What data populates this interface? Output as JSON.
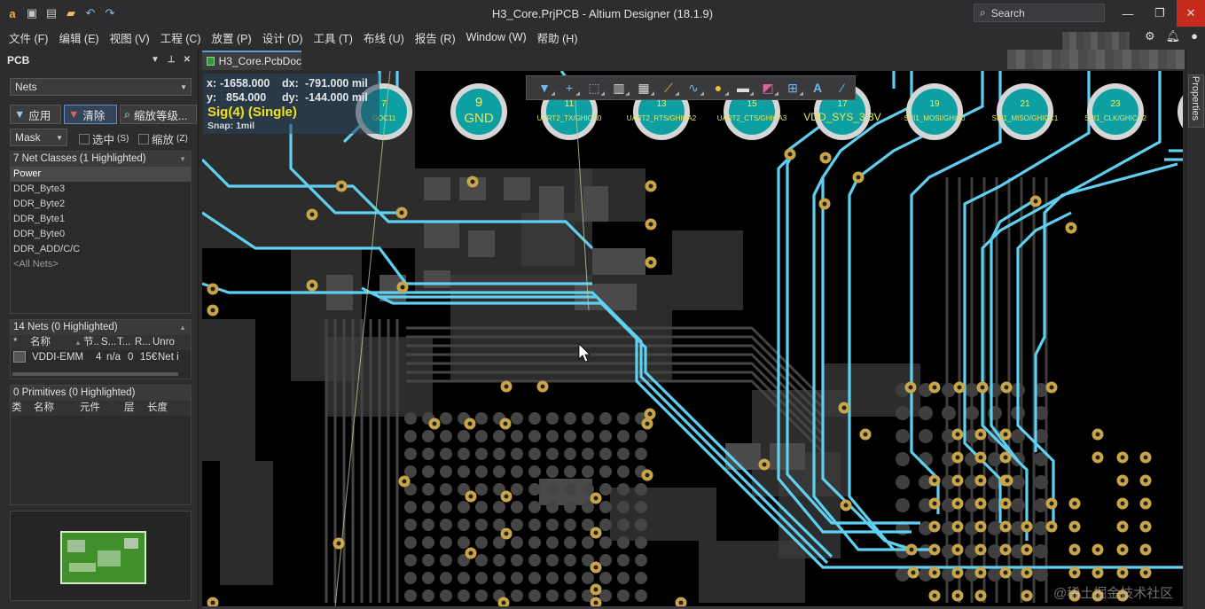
{
  "titlebar": {
    "title": "H3_Core.PrjPCB - Altium Designer (18.1.9)",
    "search_label": "Search",
    "quick_icons": [
      "app-logo-icon",
      "save-icon",
      "save-all-icon",
      "open-folder-icon",
      "undo-icon",
      "redo-icon"
    ]
  },
  "menu": {
    "items": [
      "文件 (F)",
      "编辑 (E)",
      "视图 (V)",
      "工程 (C)",
      "放置 (P)",
      "设计 (D)",
      "工具 (T)",
      "布线 (U)",
      "报告 (R)",
      "Window (W)",
      "帮助 (H)"
    ]
  },
  "panel": {
    "title": "PCB",
    "mode_select": "Nets",
    "apply_label": "应用",
    "clear_label": "清除",
    "zoom_label": "缩放等级...",
    "mask_select": "Mask",
    "select_label": "选中",
    "select_key": "(S)",
    "zoom_chk_label": "缩放",
    "zoom_chk_key": "(Z)",
    "net_classes": {
      "header": "7 Net Classes (1 Highlighted)",
      "items": [
        "Power",
        "DDR_Byte3",
        "DDR_Byte2",
        "DDR_Byte1",
        "DDR_Byte0",
        "DDR_ADD/C/C",
        "<All Nets>"
      ]
    },
    "nets": {
      "header": "14 Nets (0 Highlighted)",
      "columns": [
        "*",
        "名称",
        "节..",
        "S...",
        "T...",
        "R...",
        "Unro"
      ],
      "row": {
        "name": "VDDI-EMM",
        "nodes": "4",
        "signal": "n/a",
        "t": "0",
        "r": "15€",
        "unrouted": "Net i"
      }
    },
    "primitives": {
      "header": "0 Primitives (0 Highlighted)",
      "columns": [
        "类",
        "名称",
        "元件",
        "层",
        "长度"
      ]
    }
  },
  "document": {
    "tab_label": "H3_Core.PcbDoc"
  },
  "hud": {
    "x_label": "x:",
    "x_value": "-1658.000",
    "dx_label": "dx:",
    "dx_value": "-791.000 mil",
    "y_label": "y:",
    "y_value": "854.000",
    "dy_label": "dy:",
    "dy_value": "-144.000 mil",
    "layer": "Sig(4) (Single)",
    "snap": "Snap: 1mil"
  },
  "pads": [
    {
      "num": "7",
      "net": "GOC11"
    },
    {
      "num": "9",
      "net": "GND"
    },
    {
      "num": "11",
      "net": "UART2_TX/GHICA0"
    },
    {
      "num": "13",
      "net": "UART2_RTS/GHICA2"
    },
    {
      "num": "15",
      "net": "UART2_CTS/GHICA3"
    },
    {
      "num": "17",
      "net": "VDD_SYS_3.3V"
    },
    {
      "num": "19",
      "net": "SPI1_MOSI/GHIC0"
    },
    {
      "num": "21",
      "net": "SPI1_MISO/GHICC1"
    },
    {
      "num": "23",
      "net": "SPI1_CLK/GHICC2"
    }
  ],
  "side_panel": {
    "properties_label": "Properties"
  },
  "watermark": "@稀土掘金技术社区",
  "colors": {
    "trace": "#5fd0f0",
    "via": "#c9a54a",
    "copper": "#3b3b3b",
    "pad": "#0e9fa3",
    "hud_layer": "#f0e020"
  }
}
